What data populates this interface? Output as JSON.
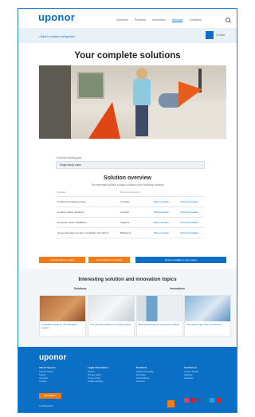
{
  "header": {
    "logo": "uponor",
    "nav": [
      "Solutions",
      "Products",
      "Innovation",
      "Services",
      "Company"
    ],
    "active_index": 3
  },
  "subbar": {
    "back_link": "< Back to solution configurator",
    "contact": "Contact"
  },
  "page_title": "Your complete solutions",
  "selection": {
    "label": "Selected building type",
    "value": "Single family home"
  },
  "overview": {
    "title": "Solution overview",
    "subtitle": "The preferable system solution consists of the following solutions",
    "headers": [
      "Solution",
      "Recommended for",
      "",
      ""
    ],
    "rows": [
      {
        "name": "Underfloor heating system",
        "for": "Comfort",
        "link1": "Show solution",
        "link2": "View information"
      },
      {
        "name": "Cooling ceiling solutions",
        "for": "Comfort",
        "link1": "Show solution",
        "link2": "View information"
      },
      {
        "name": "Domestic water installation",
        "for": "Hygiene",
        "link1": "Show solution",
        "link2": "View information"
      },
      {
        "name": "Sewer drainage & indoor ventilation and others",
        "for": "Efficiency",
        "link1": "Show solution",
        "link2": "View information"
      }
    ]
  },
  "cta": {
    "primary": "Contact Uponor expert",
    "secondary": "Print solutions overview",
    "wide": "Find an installer in your region"
  },
  "topics": {
    "title": "Interesting solution and innovation topics",
    "solutions_head": "Solutions",
    "innovations_head": "Innovations",
    "cards": [
      {
        "caption": "Underfloor heating - the complete system"
      },
      {
        "caption": "The ultimate solution for cooling space"
      },
      {
        "caption": "Best performing components in school"
      },
      {
        "caption": "The perfect tap water connection"
      }
    ]
  },
  "footer": {
    "logo": "uponor",
    "cols": [
      {
        "head": "About Uponor",
        "items": [
          "Uponor Group",
          "Career",
          "Investors",
          "Contact"
        ]
      },
      {
        "head": "Legal information",
        "items": [
          "Imprint",
          "Privacy policy",
          "Terms of use",
          "Cookie settings"
        ]
      },
      {
        "head": "Products",
        "items": [
          "Heating & cooling",
          "Plumbing",
          "Infrastructure",
          "Services"
        ]
      },
      {
        "head": "Contact us",
        "items": [
          "Uponor GmbH",
          "Hassfurt",
          "Germany"
        ]
      }
    ],
    "button": "Newsletter",
    "copyright": "© 2018 Uponor"
  },
  "colors": {
    "brand_blue": "#0a6fc5",
    "accent_orange": "#f07d1a"
  }
}
